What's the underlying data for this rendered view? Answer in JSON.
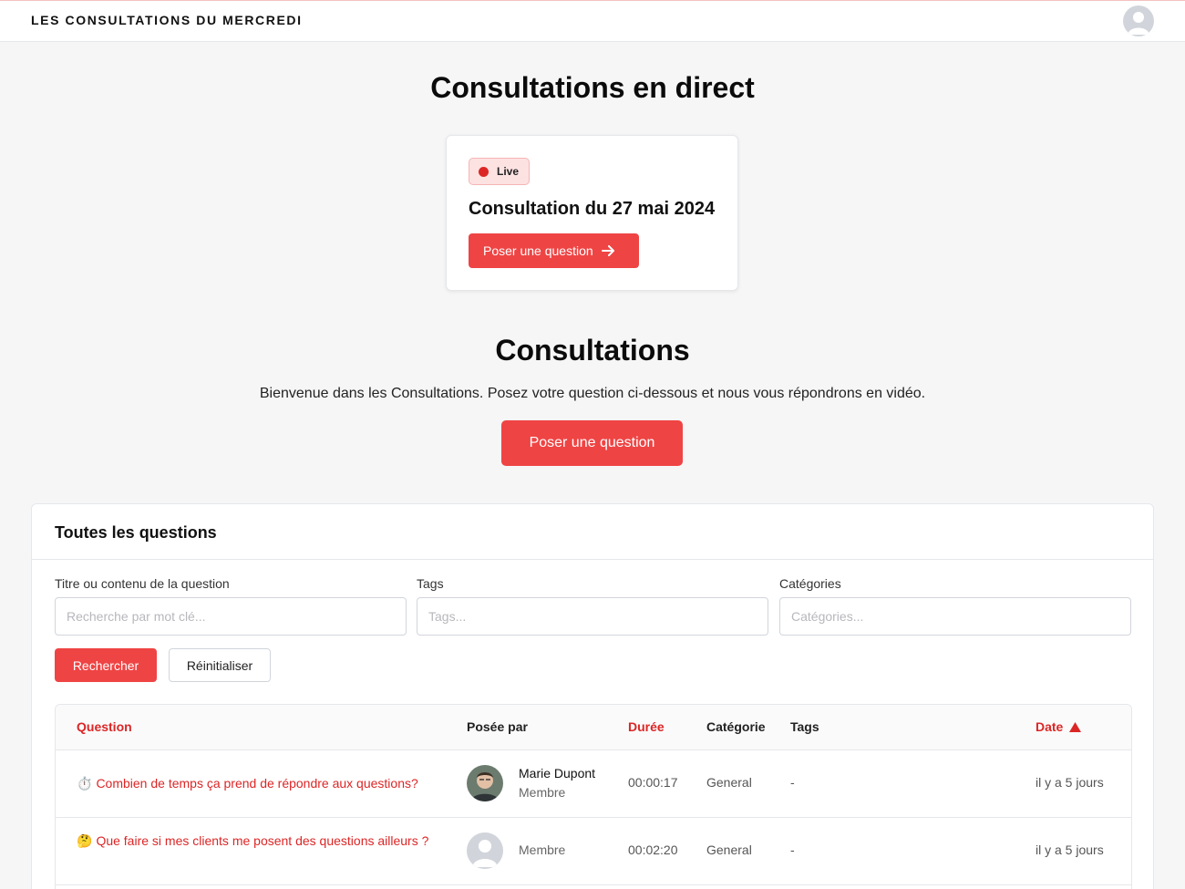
{
  "header": {
    "brand": "LES CONSULTATIONS DU MERCREDI"
  },
  "live": {
    "heading": "Consultations en direct",
    "badge": "Live",
    "title": "Consultation du 27 mai 2024",
    "button": "Poser une question"
  },
  "consultations": {
    "heading": "Consultations",
    "intro": "Bienvenue dans les Consultations. Posez votre question ci-dessous et nous vous répondrons en vidéo.",
    "button": "Poser une question"
  },
  "questions": {
    "title": "Toutes les questions",
    "filters": {
      "query_label": "Titre ou contenu de la question",
      "query_placeholder": "Recherche par mot clé...",
      "tags_label": "Tags",
      "tags_placeholder": "Tags...",
      "categories_label": "Catégories",
      "categories_placeholder": "Catégories...",
      "search_button": "Rechercher",
      "reset_button": "Réinitialiser"
    },
    "columns": {
      "question": "Question",
      "asked_by": "Posée par",
      "duration": "Durée",
      "category": "Catégorie",
      "tags": "Tags",
      "date": "Date",
      "date_sort_icon": "triangle-up-icon"
    },
    "rows": [
      {
        "emoji": "⏱️",
        "question": "Combien de temps ça prend de répondre aux questions?",
        "name": "Marie Dupont",
        "role": "Membre",
        "duration": "00:00:17",
        "category": "General",
        "tags": "-",
        "date": "il y a 5 jours"
      },
      {
        "emoji": "🤔",
        "question": "Que faire si mes clients me posent des questions ailleurs ?",
        "name": "",
        "role": "Membre",
        "duration": "00:02:20",
        "category": "General",
        "tags": "-",
        "date": "il y a 5 jours"
      }
    ]
  },
  "colors": {
    "accent": "#ef4444",
    "accent_text": "#dc2626",
    "background": "#f6f6f7"
  }
}
